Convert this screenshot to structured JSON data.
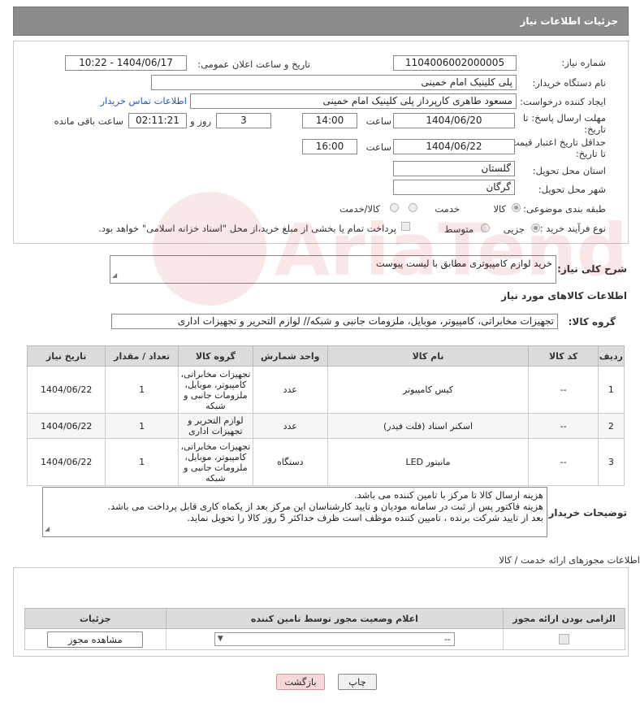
{
  "header": {
    "title": "جزئیات اطلاعات نیاز"
  },
  "form": {
    "need_number_label": "شماره نیاز:",
    "need_number": "1104006002000005",
    "announce_label": "تاریخ و ساعت اعلان عمومی:",
    "announce_value": "1404/06/17 - 10:22",
    "buyer_org_label": "نام دستگاه خریدار:",
    "buyer_org": "پلی کلینیک امام خمینی",
    "creator_label": "ایجاد کننده درخواست:",
    "creator": "مسعود طاهری کارپرداز پلی کلینیک امام خمینی",
    "contact_link": "اطلاعات تماس خریدار",
    "deadline_label_1": "مهلت ارسال پاسخ: تا",
    "deadline_label_2": "تاریخ:",
    "deadline_date": "1404/06/20",
    "time_label": "ساعت",
    "deadline_time": "14:00",
    "days_value": "3",
    "days_label": "روز و",
    "remaining_time": "02:11:21",
    "remaining_label": "ساعت باقی مانده",
    "min_valid_label_1": "حداقل تاریخ اعتبار قیمت:",
    "min_valid_label_2": "تا تاریخ:",
    "min_valid_date": "1404/06/22",
    "min_valid_time": "16:00",
    "province_label": "استان محل تحویل:",
    "province": "گلستان",
    "city_label": "شهر محل تحویل:",
    "city": "گرگان",
    "category_label": "طبقه بندی موضوعی:",
    "category_options": [
      "کالا",
      "خدمت",
      "کالا/خدمت"
    ],
    "process_label": "نوع فرآیند خرید :",
    "process_options": [
      "جزیی",
      "متوسط"
    ],
    "payment_note": "پرداخت تمام یا بخشی از مبلغ خرید،از محل \"اسناد خزانه اسلامی\" خواهد بود."
  },
  "description": {
    "label": "شرح کلی نیاز:",
    "value": "خرید لوازم کامپیوتری مطابق با لیست پیوست"
  },
  "goods_section": {
    "title": "اطلاعات کالاهای مورد نیاز",
    "group_label": "گروه کالا:",
    "group_value": "تجهیزات مخابراتی، کامپیوتر، موبایل، ملزومات جانبی و شبکه// لوازم التحریر و تجهیزات اداری",
    "columns": [
      "ردیف",
      "کد کالا",
      "نام کالا",
      "واحد شمارش",
      "گروه کالا",
      "تعداد / مقدار",
      "تاریخ نیاز"
    ],
    "rows": [
      {
        "idx": "1",
        "code": "--",
        "name": "کیس کامپیوتر",
        "unit": "عدد",
        "group": "تجهیزات مخابراتی، کامپیوتر، موبایل، ملزومات جانبی و شبکه",
        "qty": "1",
        "date": "1404/06/22"
      },
      {
        "idx": "2",
        "code": "--",
        "name": "اسکنر اسناد (فلت فیدر)",
        "unit": "عدد",
        "group": "لوازم التحریر و تجهیزات اداری",
        "qty": "1",
        "date": "1404/06/22"
      },
      {
        "idx": "3",
        "code": "--",
        "name": "مانیتور LED",
        "unit": "دستگاه",
        "group": "تجهیزات مخابراتی، کامپیوتر، موبایل، ملزومات جانبی و شبکه",
        "qty": "1",
        "date": "1404/06/22"
      }
    ]
  },
  "buyer_notes": {
    "label": "توضیحات خریدار:",
    "lines": [
      "هزینه ارسال کالا تا مرکز با تامین کننده می باشد.",
      "هزینه فاکتور پس از ثبت در سامانه مودیان و تایید کارشناسان این مرکز بعد از یکماه کاری قابل پرداخت می باشد.",
      "بعد از تایید شرکت برنده ، تامیین کننده موظف است ظرف حداکثر 5 روز کالا را تحویل نماید."
    ]
  },
  "license_section": {
    "title": "اطلاعات مجوزهای ارائه خدمت / کالا",
    "columns": [
      "الزامی بودن ارائه مجوز",
      "اعلام وضعیت مجوز توسط تامین کننده",
      "جزئیات"
    ],
    "select_value": "--",
    "view_button": "مشاهده مجوز"
  },
  "actions": {
    "print": "چاپ",
    "back": "بازگشت"
  },
  "watermark": {
    "text": "AriaTender.neT"
  }
}
